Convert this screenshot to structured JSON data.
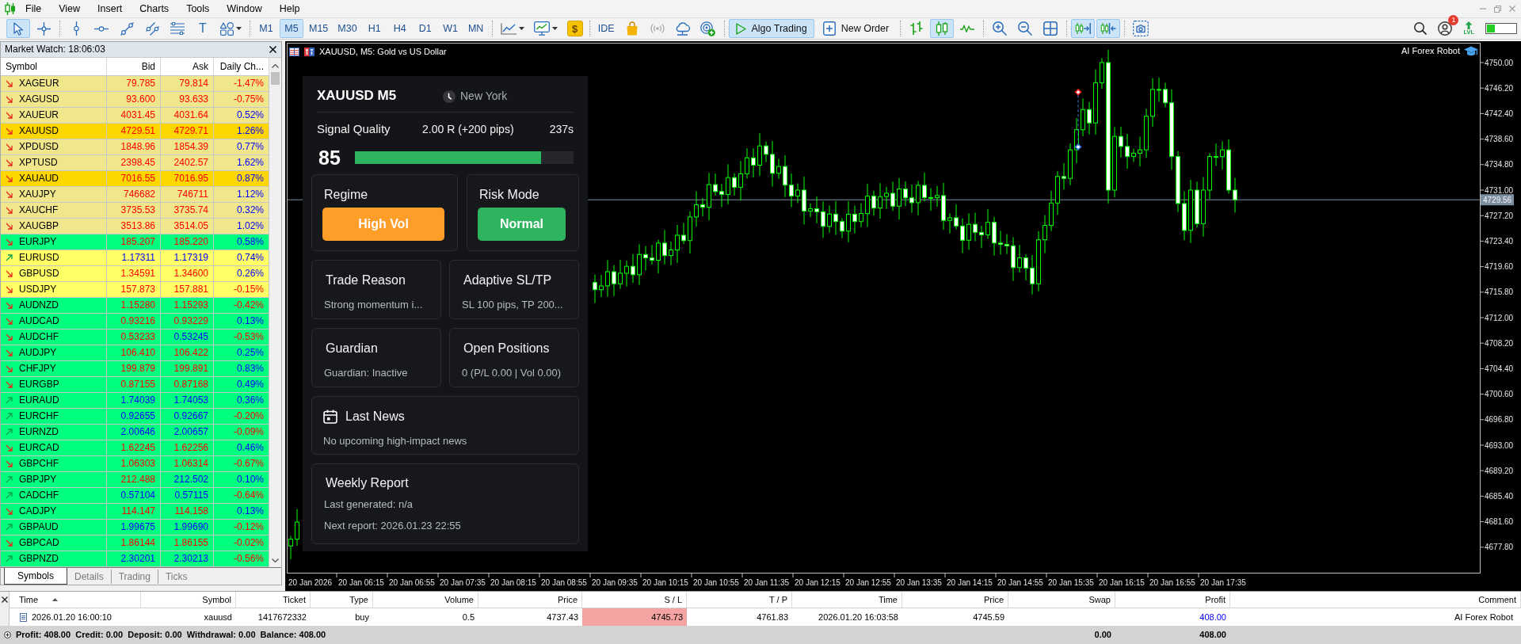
{
  "menu": [
    "File",
    "View",
    "Insert",
    "Charts",
    "Tools",
    "Window",
    "Help"
  ],
  "toolbar": {
    "groups": [
      [
        {
          "kind": "icon",
          "selected": true
        },
        {
          "kind": "icon",
          "selected": false
        }
      ],
      [
        {
          "kind": "icon",
          "selected": false
        },
        {
          "kind": "icon",
          "selected": false
        },
        {
          "kind": "icon",
          "selected": false
        },
        {
          "kind": "icon",
          "selected": false
        },
        {
          "kind": "icon",
          "selected": false
        },
        {
          "kind": "text",
          "label": "T",
          "selected": false
        },
        {
          "kind": "dropdown",
          "selected": false
        }
      ],
      [
        {
          "kind": "text",
          "label": "M1",
          "selected": false
        },
        {
          "kind": "text",
          "label": "M5",
          "selected": true
        },
        {
          "kind": "text",
          "label": "M15",
          "selected": false
        },
        {
          "kind": "text",
          "label": "M30",
          "selected": false
        },
        {
          "kind": "text",
          "label": "H1",
          "selected": false
        },
        {
          "kind": "text",
          "label": "H4",
          "selected": false
        },
        {
          "kind": "text",
          "label": "D1",
          "selected": false
        },
        {
          "kind": "text",
          "label": "W1",
          "selected": false
        },
        {
          "kind": "text",
          "label": "MN",
          "selected": false
        }
      ],
      [
        {
          "kind": "dropdown",
          "selected": false
        },
        {
          "kind": "dropdown",
          "selected": false
        },
        {
          "kind": "tile",
          "label": "$",
          "selected": false
        }
      ],
      [
        {
          "kind": "text",
          "label": "IDE",
          "selected": false
        },
        {
          "kind": "icon",
          "selected": false
        },
        {
          "kind": "icon",
          "selected": false
        },
        {
          "kind": "icon",
          "selected": false
        },
        {
          "kind": "icon",
          "selected": false
        }
      ],
      [
        {
          "kind": "labeled",
          "label": "Algo Trading",
          "selected": true
        },
        {
          "kind": "labeled",
          "label": "New Order",
          "selected": false
        }
      ],
      [
        {
          "kind": "icon",
          "selected": false
        },
        {
          "kind": "icon",
          "selected": true
        },
        {
          "kind": "icon",
          "selected": false
        }
      ],
      [
        {
          "kind": "icon",
          "selected": false
        },
        {
          "kind": "icon",
          "selected": false
        },
        {
          "kind": "icon",
          "selected": false
        }
      ],
      [
        {
          "kind": "icon",
          "selected": true
        },
        {
          "kind": "icon",
          "selected": true
        }
      ],
      [
        {
          "kind": "icon",
          "selected": false
        }
      ]
    ],
    "notification_count": "1",
    "level_label": "LVL"
  },
  "market_watch": {
    "title": "Market Watch: 18:06:03",
    "columns": [
      "Symbol",
      "Bid",
      "Ask",
      "Daily Ch..."
    ],
    "rows": [
      {
        "symbol": "XAGEUR",
        "rising": false,
        "color": "#f0e68c",
        "bid": {
          "value": "79.785",
          "up": false
        },
        "ask": {
          "value": "79.814",
          "up": false
        },
        "change": {
          "value": "-1.47%",
          "up": false
        }
      },
      {
        "symbol": "XAGUSD",
        "rising": false,
        "color": "#f0e68c",
        "bid": {
          "value": "93.600",
          "up": false
        },
        "ask": {
          "value": "93.633",
          "up": false
        },
        "change": {
          "value": "-0.75%",
          "up": false
        }
      },
      {
        "symbol": "XAUEUR",
        "rising": false,
        "color": "#f0e68c",
        "bid": {
          "value": "4031.45",
          "up": false
        },
        "ask": {
          "value": "4031.64",
          "up": false
        },
        "change": {
          "value": "0.52%",
          "up": true
        }
      },
      {
        "symbol": "XAUUSD",
        "rising": false,
        "color": "#ffd700",
        "bid": {
          "value": "4729.51",
          "up": false
        },
        "ask": {
          "value": "4729.71",
          "up": false
        },
        "change": {
          "value": "1.26%",
          "up": true
        }
      },
      {
        "symbol": "XPDUSD",
        "rising": false,
        "color": "#f0e68c",
        "bid": {
          "value": "1848.96",
          "up": false
        },
        "ask": {
          "value": "1854.39",
          "up": false
        },
        "change": {
          "value": "0.77%",
          "up": true
        }
      },
      {
        "symbol": "XPTUSD",
        "rising": false,
        "color": "#f0e68c",
        "bid": {
          "value": "2398.45",
          "up": false
        },
        "ask": {
          "value": "2402.57",
          "up": false
        },
        "change": {
          "value": "1.62%",
          "up": true
        }
      },
      {
        "symbol": "XAUAUD",
        "rising": false,
        "color": "#ffd700",
        "bid": {
          "value": "7016.55",
          "up": false
        },
        "ask": {
          "value": "7016.95",
          "up": false
        },
        "change": {
          "value": "0.87%",
          "up": true
        }
      },
      {
        "symbol": "XAUJPY",
        "rising": false,
        "color": "#f0e68c",
        "bid": {
          "value": "746682",
          "up": false
        },
        "ask": {
          "value": "746711",
          "up": false
        },
        "change": {
          "value": "1.12%",
          "up": true
        }
      },
      {
        "symbol": "XAUCHF",
        "rising": false,
        "color": "#f0e68c",
        "bid": {
          "value": "3735.53",
          "up": false
        },
        "ask": {
          "value": "3735.74",
          "up": false
        },
        "change": {
          "value": "0.32%",
          "up": true
        }
      },
      {
        "symbol": "XAUGBP",
        "rising": false,
        "color": "#f0e68c",
        "bid": {
          "value": "3513.86",
          "up": false
        },
        "ask": {
          "value": "3514.05",
          "up": false
        },
        "change": {
          "value": "1.02%",
          "up": true
        }
      },
      {
        "symbol": "EURJPY",
        "rising": false,
        "color": "#00ff7f",
        "bid": {
          "value": "185.207",
          "up": false
        },
        "ask": {
          "value": "185.220",
          "up": false
        },
        "change": {
          "value": "0.58%",
          "up": true
        }
      },
      {
        "symbol": "EURUSD",
        "rising": true,
        "color": "#ffff66",
        "bid": {
          "value": "1.17311",
          "up": true
        },
        "ask": {
          "value": "1.17319",
          "up": true
        },
        "change": {
          "value": "0.74%",
          "up": true
        }
      },
      {
        "symbol": "GBPUSD",
        "rising": false,
        "color": "#ffff66",
        "bid": {
          "value": "1.34591",
          "up": false
        },
        "ask": {
          "value": "1.34600",
          "up": false
        },
        "change": {
          "value": "0.26%",
          "up": true
        }
      },
      {
        "symbol": "USDJPY",
        "rising": false,
        "color": "#ffff66",
        "bid": {
          "value": "157.873",
          "up": false
        },
        "ask": {
          "value": "157.881",
          "up": false
        },
        "change": {
          "value": "-0.15%",
          "up": false
        }
      },
      {
        "symbol": "AUDNZD",
        "rising": false,
        "color": "#00ff7f",
        "bid": {
          "value": "1.15280",
          "up": false
        },
        "ask": {
          "value": "1.15293",
          "up": false
        },
        "change": {
          "value": "-0.42%",
          "up": false
        }
      },
      {
        "symbol": "AUDCAD",
        "rising": false,
        "color": "#00ff7f",
        "bid": {
          "value": "0.93216",
          "up": false
        },
        "ask": {
          "value": "0.93229",
          "up": false
        },
        "change": {
          "value": "0.13%",
          "up": true
        }
      },
      {
        "symbol": "AUDCHF",
        "rising": false,
        "color": "#00ff7f",
        "bid": {
          "value": "0.53233",
          "up": false
        },
        "ask": {
          "value": "0.53245",
          "up": true
        },
        "change": {
          "value": "-0.53%",
          "up": false
        }
      },
      {
        "symbol": "AUDJPY",
        "rising": false,
        "color": "#00ff7f",
        "bid": {
          "value": "106.410",
          "up": false
        },
        "ask": {
          "value": "106.422",
          "up": false
        },
        "change": {
          "value": "0.25%",
          "up": true
        }
      },
      {
        "symbol": "CHFJPY",
        "rising": false,
        "color": "#00ff7f",
        "bid": {
          "value": "199.879",
          "up": false
        },
        "ask": {
          "value": "199.891",
          "up": false
        },
        "change": {
          "value": "0.83%",
          "up": true
        }
      },
      {
        "symbol": "EURGBP",
        "rising": false,
        "color": "#00ff7f",
        "bid": {
          "value": "0.87155",
          "up": false
        },
        "ask": {
          "value": "0.87168",
          "up": false
        },
        "change": {
          "value": "0.49%",
          "up": true
        }
      },
      {
        "symbol": "EURAUD",
        "rising": true,
        "color": "#00ff7f",
        "bid": {
          "value": "1.74039",
          "up": true
        },
        "ask": {
          "value": "1.74053",
          "up": true
        },
        "change": {
          "value": "0.36%",
          "up": true
        }
      },
      {
        "symbol": "EURCHF",
        "rising": true,
        "color": "#00ff7f",
        "bid": {
          "value": "0.92655",
          "up": true
        },
        "ask": {
          "value": "0.92667",
          "up": true
        },
        "change": {
          "value": "-0.20%",
          "up": false
        }
      },
      {
        "symbol": "EURNZD",
        "rising": true,
        "color": "#00ff7f",
        "bid": {
          "value": "2.00646",
          "up": true
        },
        "ask": {
          "value": "2.00657",
          "up": true
        },
        "change": {
          "value": "-0.09%",
          "up": false
        }
      },
      {
        "symbol": "EURCAD",
        "rising": false,
        "color": "#00ff7f",
        "bid": {
          "value": "1.62245",
          "up": false
        },
        "ask": {
          "value": "1.62256",
          "up": false
        },
        "change": {
          "value": "0.46%",
          "up": true
        }
      },
      {
        "symbol": "GBPCHF",
        "rising": false,
        "color": "#00ff7f",
        "bid": {
          "value": "1.06303",
          "up": false
        },
        "ask": {
          "value": "1.06314",
          "up": false
        },
        "change": {
          "value": "-0.67%",
          "up": false
        }
      },
      {
        "symbol": "GBPJPY",
        "rising": true,
        "color": "#00ff7f",
        "bid": {
          "value": "212.488",
          "up": false
        },
        "ask": {
          "value": "212.502",
          "up": true
        },
        "change": {
          "value": "0.10%",
          "up": true
        }
      },
      {
        "symbol": "CADCHF",
        "rising": true,
        "color": "#00ff7f",
        "bid": {
          "value": "0.57104",
          "up": true
        },
        "ask": {
          "value": "0.57115",
          "up": true
        },
        "change": {
          "value": "-0.64%",
          "up": false
        }
      },
      {
        "symbol": "CADJPY",
        "rising": false,
        "color": "#00ff7f",
        "bid": {
          "value": "114.147",
          "up": false
        },
        "ask": {
          "value": "114.158",
          "up": false
        },
        "change": {
          "value": "0.13%",
          "up": true
        }
      },
      {
        "symbol": "GBPAUD",
        "rising": true,
        "color": "#00ff7f",
        "bid": {
          "value": "1.99675",
          "up": true
        },
        "ask": {
          "value": "1.99690",
          "up": true
        },
        "change": {
          "value": "-0.12%",
          "up": false
        }
      },
      {
        "symbol": "GBPCAD",
        "rising": false,
        "color": "#00ff7f",
        "bid": {
          "value": "1.86144",
          "up": false
        },
        "ask": {
          "value": "1.86155",
          "up": false
        },
        "change": {
          "value": "-0.02%",
          "up": false
        }
      },
      {
        "symbol": "GBPNZD",
        "rising": true,
        "color": "#00ff7f",
        "bid": {
          "value": "2.30201",
          "up": true
        },
        "ask": {
          "value": "2.30213",
          "up": true
        },
        "change": {
          "value": "-0.56%",
          "up": false
        }
      }
    ],
    "tabs": [
      {
        "label": "Symbols",
        "selected": true
      },
      {
        "label": "Details",
        "selected": false
      },
      {
        "label": "Trading",
        "selected": false
      },
      {
        "label": "Ticks",
        "selected": false
      }
    ]
  },
  "chart": {
    "title": "XAUUSD, M5:  Gold vs US Dollar",
    "expert": "AI Forex Robot",
    "price_labels": [
      "4750.00",
      "4746.20",
      "4742.40",
      "4738.60",
      "4734.80",
      "4731.00",
      "4727.20",
      "4723.40",
      "4719.60",
      "4715.80",
      "4712.00",
      "4708.20",
      "4704.40",
      "4700.60",
      "4696.80",
      "4693.00",
      "4689.20",
      "4685.40",
      "4681.60",
      "4677.80"
    ],
    "current_price": "4729.56",
    "time_labels": [
      "20 Jan 2026",
      "20 Jan 06:15",
      "20 Jan 06:55",
      "20 Jan 07:35",
      "20 Jan 08:15",
      "20 Jan 08:55",
      "20 Jan 09:35",
      "20 Jan 10:15",
      "20 Jan 10:55",
      "20 Jan 11:35",
      "20 Jan 12:15",
      "20 Jan 12:55",
      "20 Jan 13:35",
      "20 Jan 14:15",
      "20 Jan 14:55",
      "20 Jan 15:35",
      "20 Jan 16:15",
      "20 Jan 16:55",
      "20 Jan 17:35"
    ]
  },
  "panel": {
    "symbol": "XAUUSD M5",
    "session": "New York",
    "signal": {
      "label": "Signal Quality",
      "target": "2.00 R (+200 pips)",
      "countdown": "237s",
      "score": "85",
      "level": 0.85
    },
    "status_cards": [
      {
        "title": "Regime",
        "value": "High Vol",
        "color": "#ff9d29"
      },
      {
        "title": "Risk Mode",
        "value": "Normal",
        "color": "#2eb35f"
      }
    ],
    "info_cards": [
      {
        "title": "Trade Reason",
        "text": "Strong momentum i..."
      },
      {
        "title": "Adaptive SL/TP",
        "text": "SL 100 pips, TP 200..."
      },
      {
        "title": "Guardian",
        "text": "Guardian: Inactive"
      },
      {
        "title": "Open Positions",
        "text": "0 (P/L 0.00 | Vol 0.00)"
      }
    ],
    "news": {
      "title": "Last News",
      "text": "No upcoming high-impact news"
    },
    "weekly_report": {
      "title": "Weekly Report",
      "lines": [
        "Last generated: n/a",
        "Next report: 2026.01.23 22:55"
      ]
    }
  },
  "toolbox": {
    "columns": [
      {
        "label": "Time",
        "sorted": true
      },
      {
        "label": "Symbol",
        "sorted": false
      },
      {
        "label": "Ticket",
        "sorted": false
      },
      {
        "label": "Type",
        "sorted": false
      },
      {
        "label": "Volume",
        "sorted": false
      },
      {
        "label": "Price",
        "sorted": false
      },
      {
        "label": "S / L",
        "sorted": false
      },
      {
        "label": "T / P",
        "sorted": false
      },
      {
        "label": "Time",
        "sorted": false
      },
      {
        "label": "Price",
        "sorted": false
      },
      {
        "label": "Swap",
        "sorted": false
      },
      {
        "label": "Profit",
        "sorted": false
      },
      {
        "label": "Comment",
        "sorted": false
      }
    ],
    "rows": [
      {
        "open_time": "2026.01.20 16:00:10",
        "symbol": "xauusd",
        "ticket": "1417672332",
        "type": "buy",
        "volume": "0.5",
        "open_price": "4737.43",
        "sl": "4745.73",
        "tp": "4761.83",
        "close_time": "2026.01.20 16:03:58",
        "close_price": "4745.59",
        "profit": {
          "value": "408.00",
          "positive": true
        },
        "comment": "AI Forex Robot",
        "sl_highlighted": true
      }
    ],
    "summary": {
      "text": "Profit: 408.00  Credit: 0.00  Deposit: 0.00  Withdrawal: 0.00  Balance: 408.00",
      "swap": "0.00",
      "profit": "408.00"
    }
  }
}
